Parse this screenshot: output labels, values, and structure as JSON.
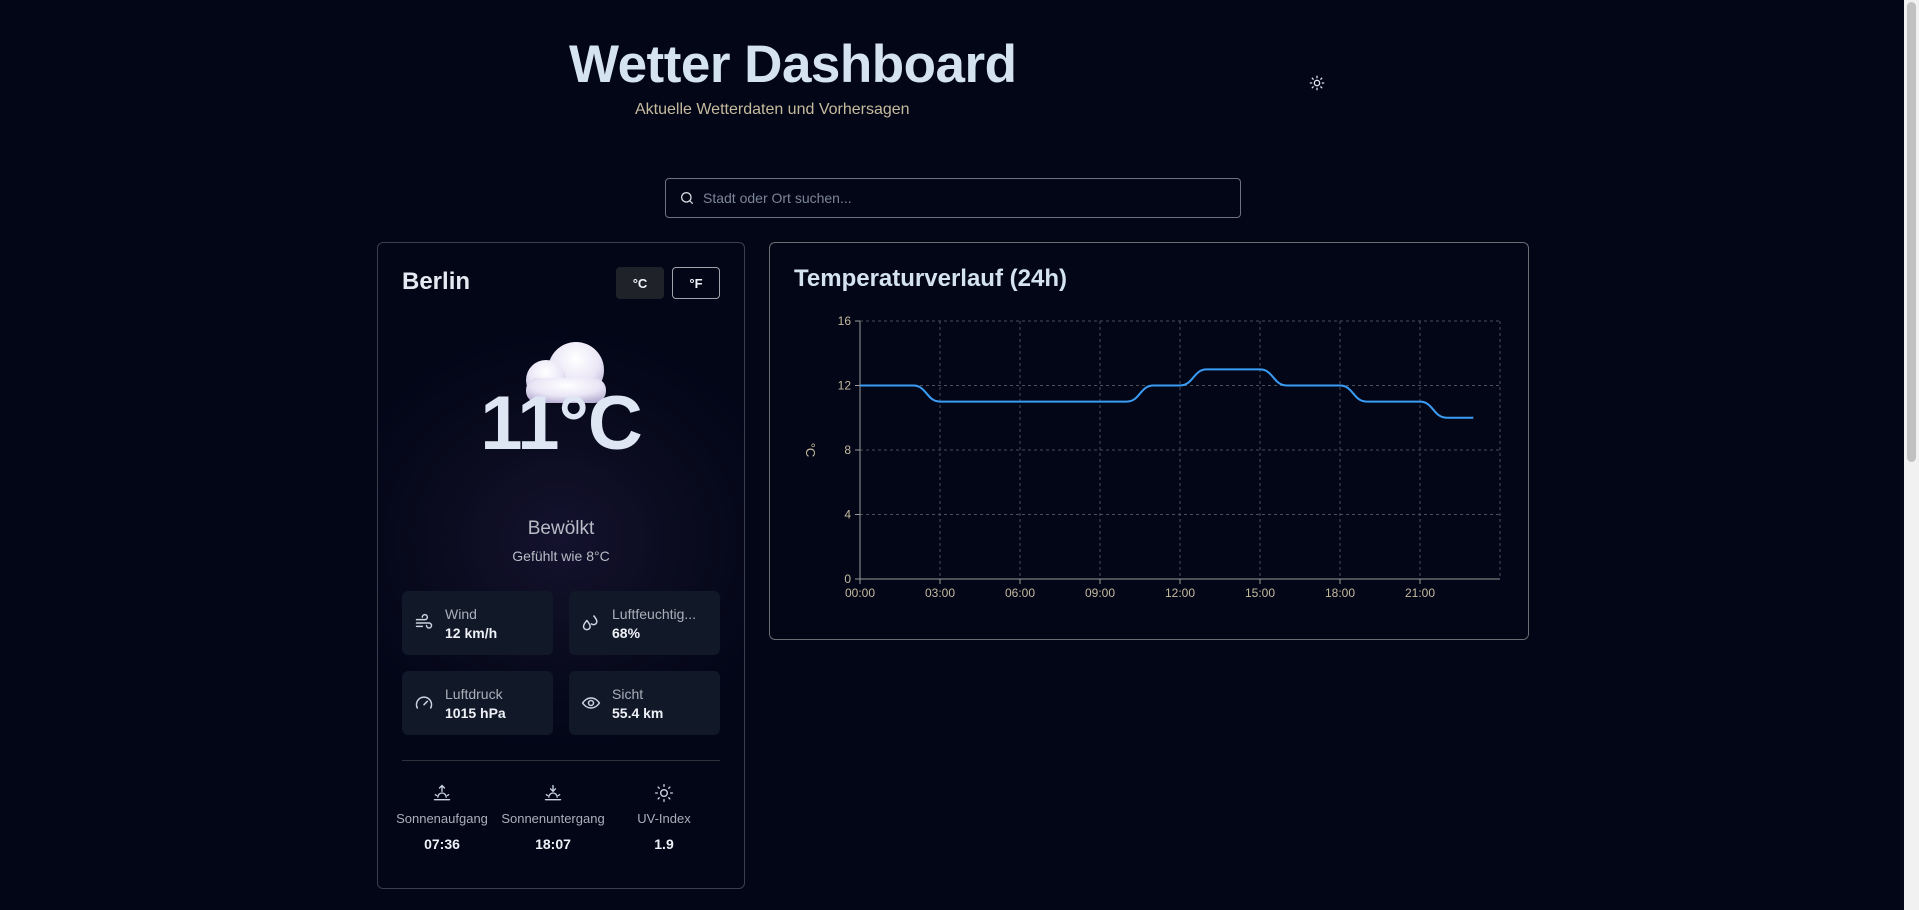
{
  "header": {
    "title": "Wetter Dashboard",
    "subtitle": "Aktuelle Wetterdaten und Vorhersagen",
    "theme_icon": "sun-icon"
  },
  "search": {
    "placeholder": "Stadt oder Ort suchen...",
    "value": ""
  },
  "current": {
    "city": "Berlin",
    "unit_c": "°C",
    "unit_f": "°F",
    "active_unit": "°C",
    "icon": "cloud-icon",
    "temperature": "11°C",
    "condition": "Bewölkt",
    "feels_like": "Gefühlt wie 8°C",
    "stats": [
      {
        "label": "Wind",
        "value": "12 km/h",
        "icon": "wind-icon"
      },
      {
        "label": "Luftfeuchtig...",
        "value": "68%",
        "icon": "droplets-icon"
      },
      {
        "label": "Luftdruck",
        "value": "1015 hPa",
        "icon": "gauge-icon"
      },
      {
        "label": "Sicht",
        "value": "55.4 km",
        "icon": "eye-icon"
      }
    ],
    "sun": [
      {
        "label": "Sonnenaufgang",
        "value": "07:36",
        "icon": "sunrise-icon"
      },
      {
        "label": "Sonnenuntergang",
        "value": "18:07",
        "icon": "sunset-icon"
      },
      {
        "label": "UV-Index",
        "value": "1.9",
        "icon": "sun-icon"
      }
    ]
  },
  "chart": {
    "title": "Temperaturverlauf (24h)"
  },
  "chart_data": {
    "type": "line",
    "title": "Temperaturverlauf (24h)",
    "xlabel": "",
    "ylabel": "°C",
    "x": [
      "00:00",
      "01:00",
      "02:00",
      "03:00",
      "04:00",
      "05:00",
      "06:00",
      "07:00",
      "08:00",
      "09:00",
      "10:00",
      "11:00",
      "12:00",
      "13:00",
      "14:00",
      "15:00",
      "16:00",
      "17:00",
      "18:00",
      "19:00",
      "20:00",
      "21:00",
      "22:00",
      "23:00"
    ],
    "x_ticks": [
      "00:00",
      "03:00",
      "06:00",
      "09:00",
      "12:00",
      "15:00",
      "18:00",
      "21:00"
    ],
    "series": [
      {
        "values": [
          12,
          12,
          12,
          11,
          11,
          11,
          11,
          11,
          11,
          11,
          11,
          12,
          12,
          13,
          13,
          13,
          12,
          12,
          12,
          11,
          11,
          11,
          10,
          10
        ],
        "color": "#3b9cf5"
      }
    ],
    "ylim": [
      0,
      16
    ],
    "y_ticks": [
      0,
      4,
      8,
      12,
      16
    ],
    "grid": true,
    "grid_style": "dashed"
  },
  "colors": {
    "background": "#020617",
    "line": "#3b9cf5",
    "title": "#d5e3f1",
    "subtitle": "#c7bb9e"
  }
}
